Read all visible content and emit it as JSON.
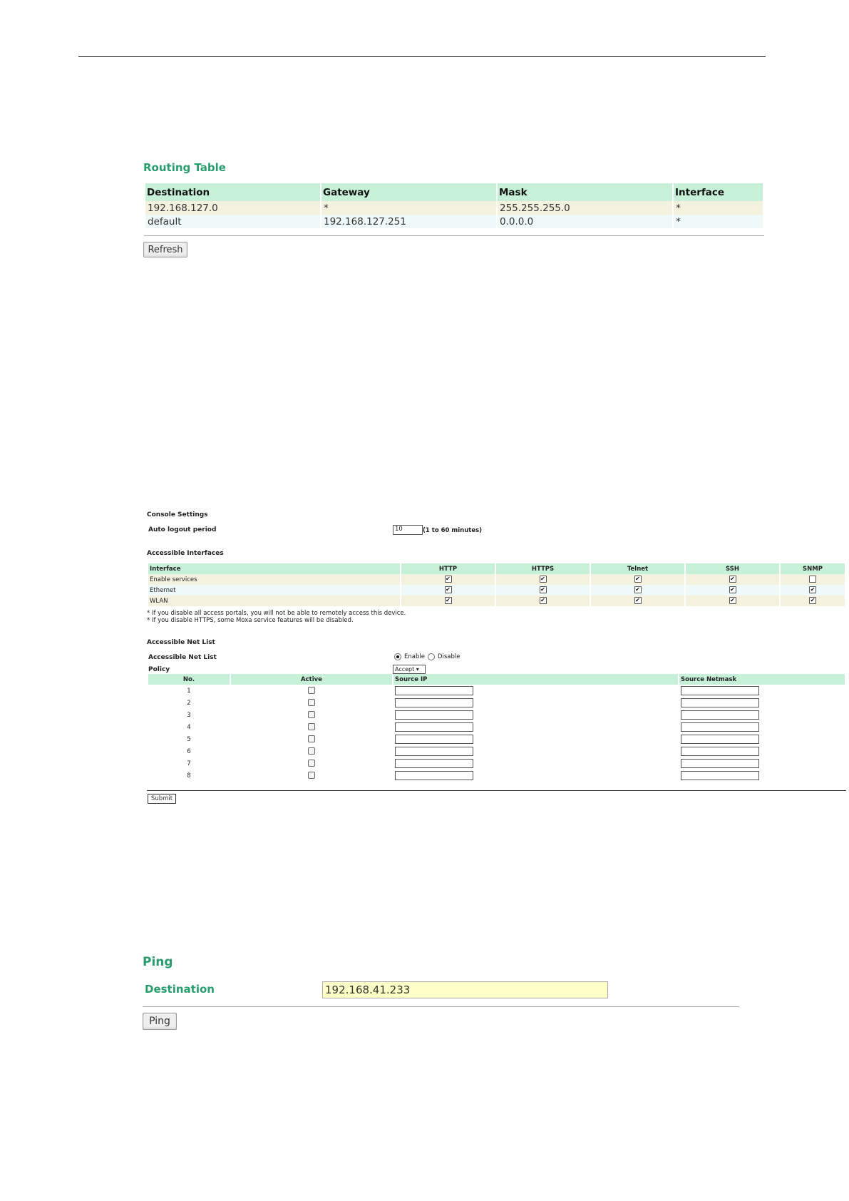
{
  "routing": {
    "title": "Routing Table",
    "headers": [
      "Destination",
      "Gateway",
      "Mask",
      "Interface"
    ],
    "rows": [
      [
        "192.168.127.0",
        "*",
        "255.255.255.0",
        "*"
      ],
      [
        "default",
        "192.168.127.251",
        "0.0.0.0",
        "*"
      ]
    ],
    "refresh_label": "Refresh"
  },
  "console": {
    "title": "Console Settings",
    "auto_logout_label": "Auto logout period",
    "auto_logout_value": "10",
    "auto_logout_hint": "(1 to 60 minutes)",
    "interfaces_title": "Accessible Interfaces",
    "interfaces_headers": [
      "Interface",
      "HTTP",
      "HTTPS",
      "Telnet",
      "SSH",
      "SNMP"
    ],
    "interfaces_rows": [
      {
        "name": "Enable services",
        "checks": [
          true,
          true,
          true,
          true,
          false
        ]
      },
      {
        "name": "Ethernet",
        "checks": [
          true,
          true,
          true,
          true,
          true
        ]
      },
      {
        "name": "WLAN",
        "checks": [
          true,
          true,
          true,
          true,
          true
        ]
      }
    ],
    "note1": "* If you disable all access portals, you will not be able to remotely access this device.",
    "note2": "* If you disable HTTPS, some Moxa service features will be disabled.",
    "netlist_title": "Accessible Net List",
    "netlist_label": "Accessible Net List",
    "enable_label": "Enable",
    "disable_label": "Disable",
    "netlist_selected": "Enable",
    "policy_label": "Policy",
    "policy_value": "Accept ▾",
    "netlist_headers": [
      "No.",
      "Active",
      "Source IP",
      "Source Netmask"
    ],
    "netlist_rows": [
      "1",
      "2",
      "3",
      "4",
      "5",
      "6",
      "7",
      "8"
    ],
    "submit_label": "Submit"
  },
  "ping": {
    "title": "Ping",
    "dest_label": "Destination",
    "dest_value": "192.168.41.233",
    "button_label": "Ping"
  }
}
